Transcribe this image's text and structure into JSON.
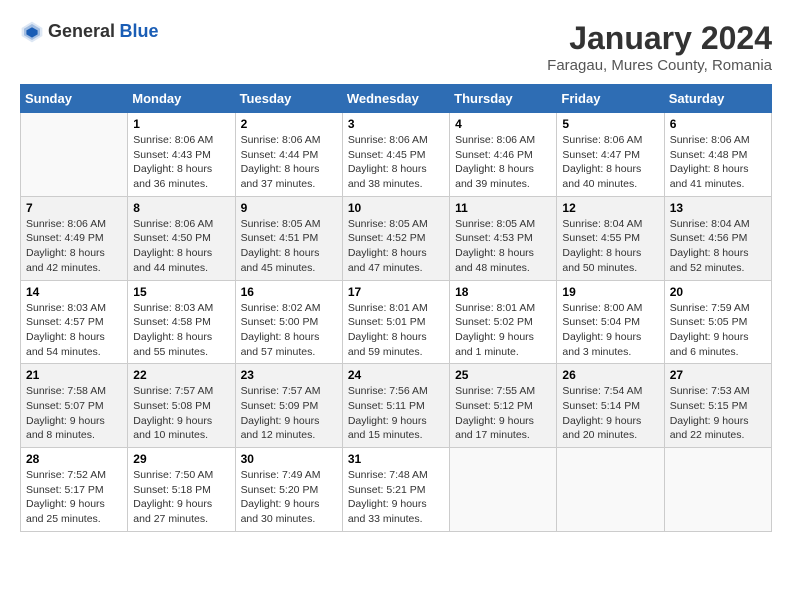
{
  "logo": {
    "general": "General",
    "blue": "Blue"
  },
  "title": "January 2024",
  "subtitle": "Faragau, Mures County, Romania",
  "headers": [
    "Sunday",
    "Monday",
    "Tuesday",
    "Wednesday",
    "Thursday",
    "Friday",
    "Saturday"
  ],
  "weeks": [
    [
      {
        "day": "",
        "sunrise": "",
        "sunset": "",
        "daylight": ""
      },
      {
        "day": "1",
        "sunrise": "Sunrise: 8:06 AM",
        "sunset": "Sunset: 4:43 PM",
        "daylight": "Daylight: 8 hours and 36 minutes."
      },
      {
        "day": "2",
        "sunrise": "Sunrise: 8:06 AM",
        "sunset": "Sunset: 4:44 PM",
        "daylight": "Daylight: 8 hours and 37 minutes."
      },
      {
        "day": "3",
        "sunrise": "Sunrise: 8:06 AM",
        "sunset": "Sunset: 4:45 PM",
        "daylight": "Daylight: 8 hours and 38 minutes."
      },
      {
        "day": "4",
        "sunrise": "Sunrise: 8:06 AM",
        "sunset": "Sunset: 4:46 PM",
        "daylight": "Daylight: 8 hours and 39 minutes."
      },
      {
        "day": "5",
        "sunrise": "Sunrise: 8:06 AM",
        "sunset": "Sunset: 4:47 PM",
        "daylight": "Daylight: 8 hours and 40 minutes."
      },
      {
        "day": "6",
        "sunrise": "Sunrise: 8:06 AM",
        "sunset": "Sunset: 4:48 PM",
        "daylight": "Daylight: 8 hours and 41 minutes."
      }
    ],
    [
      {
        "day": "7",
        "sunrise": "Sunrise: 8:06 AM",
        "sunset": "Sunset: 4:49 PM",
        "daylight": "Daylight: 8 hours and 42 minutes."
      },
      {
        "day": "8",
        "sunrise": "Sunrise: 8:06 AM",
        "sunset": "Sunset: 4:50 PM",
        "daylight": "Daylight: 8 hours and 44 minutes."
      },
      {
        "day": "9",
        "sunrise": "Sunrise: 8:05 AM",
        "sunset": "Sunset: 4:51 PM",
        "daylight": "Daylight: 8 hours and 45 minutes."
      },
      {
        "day": "10",
        "sunrise": "Sunrise: 8:05 AM",
        "sunset": "Sunset: 4:52 PM",
        "daylight": "Daylight: 8 hours and 47 minutes."
      },
      {
        "day": "11",
        "sunrise": "Sunrise: 8:05 AM",
        "sunset": "Sunset: 4:53 PM",
        "daylight": "Daylight: 8 hours and 48 minutes."
      },
      {
        "day": "12",
        "sunrise": "Sunrise: 8:04 AM",
        "sunset": "Sunset: 4:55 PM",
        "daylight": "Daylight: 8 hours and 50 minutes."
      },
      {
        "day": "13",
        "sunrise": "Sunrise: 8:04 AM",
        "sunset": "Sunset: 4:56 PM",
        "daylight": "Daylight: 8 hours and 52 minutes."
      }
    ],
    [
      {
        "day": "14",
        "sunrise": "Sunrise: 8:03 AM",
        "sunset": "Sunset: 4:57 PM",
        "daylight": "Daylight: 8 hours and 54 minutes."
      },
      {
        "day": "15",
        "sunrise": "Sunrise: 8:03 AM",
        "sunset": "Sunset: 4:58 PM",
        "daylight": "Daylight: 8 hours and 55 minutes."
      },
      {
        "day": "16",
        "sunrise": "Sunrise: 8:02 AM",
        "sunset": "Sunset: 5:00 PM",
        "daylight": "Daylight: 8 hours and 57 minutes."
      },
      {
        "day": "17",
        "sunrise": "Sunrise: 8:01 AM",
        "sunset": "Sunset: 5:01 PM",
        "daylight": "Daylight: 8 hours and 59 minutes."
      },
      {
        "day": "18",
        "sunrise": "Sunrise: 8:01 AM",
        "sunset": "Sunset: 5:02 PM",
        "daylight": "Daylight: 9 hours and 1 minute."
      },
      {
        "day": "19",
        "sunrise": "Sunrise: 8:00 AM",
        "sunset": "Sunset: 5:04 PM",
        "daylight": "Daylight: 9 hours and 3 minutes."
      },
      {
        "day": "20",
        "sunrise": "Sunrise: 7:59 AM",
        "sunset": "Sunset: 5:05 PM",
        "daylight": "Daylight: 9 hours and 6 minutes."
      }
    ],
    [
      {
        "day": "21",
        "sunrise": "Sunrise: 7:58 AM",
        "sunset": "Sunset: 5:07 PM",
        "daylight": "Daylight: 9 hours and 8 minutes."
      },
      {
        "day": "22",
        "sunrise": "Sunrise: 7:57 AM",
        "sunset": "Sunset: 5:08 PM",
        "daylight": "Daylight: 9 hours and 10 minutes."
      },
      {
        "day": "23",
        "sunrise": "Sunrise: 7:57 AM",
        "sunset": "Sunset: 5:09 PM",
        "daylight": "Daylight: 9 hours and 12 minutes."
      },
      {
        "day": "24",
        "sunrise": "Sunrise: 7:56 AM",
        "sunset": "Sunset: 5:11 PM",
        "daylight": "Daylight: 9 hours and 15 minutes."
      },
      {
        "day": "25",
        "sunrise": "Sunrise: 7:55 AM",
        "sunset": "Sunset: 5:12 PM",
        "daylight": "Daylight: 9 hours and 17 minutes."
      },
      {
        "day": "26",
        "sunrise": "Sunrise: 7:54 AM",
        "sunset": "Sunset: 5:14 PM",
        "daylight": "Daylight: 9 hours and 20 minutes."
      },
      {
        "day": "27",
        "sunrise": "Sunrise: 7:53 AM",
        "sunset": "Sunset: 5:15 PM",
        "daylight": "Daylight: 9 hours and 22 minutes."
      }
    ],
    [
      {
        "day": "28",
        "sunrise": "Sunrise: 7:52 AM",
        "sunset": "Sunset: 5:17 PM",
        "daylight": "Daylight: 9 hours and 25 minutes."
      },
      {
        "day": "29",
        "sunrise": "Sunrise: 7:50 AM",
        "sunset": "Sunset: 5:18 PM",
        "daylight": "Daylight: 9 hours and 27 minutes."
      },
      {
        "day": "30",
        "sunrise": "Sunrise: 7:49 AM",
        "sunset": "Sunset: 5:20 PM",
        "daylight": "Daylight: 9 hours and 30 minutes."
      },
      {
        "day": "31",
        "sunrise": "Sunrise: 7:48 AM",
        "sunset": "Sunset: 5:21 PM",
        "daylight": "Daylight: 9 hours and 33 minutes."
      },
      {
        "day": "",
        "sunrise": "",
        "sunset": "",
        "daylight": ""
      },
      {
        "day": "",
        "sunrise": "",
        "sunset": "",
        "daylight": ""
      },
      {
        "day": "",
        "sunrise": "",
        "sunset": "",
        "daylight": ""
      }
    ]
  ]
}
